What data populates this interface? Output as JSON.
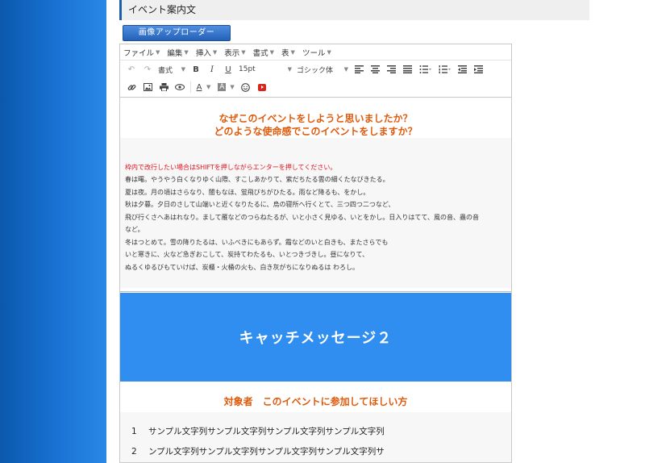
{
  "section": {
    "title": "イベント案内文"
  },
  "upload_button": {
    "label": "画像アップローダー"
  },
  "menubar": {
    "items": [
      {
        "label": "ファイル"
      },
      {
        "label": "編集"
      },
      {
        "label": "挿入"
      },
      {
        "label": "表示"
      },
      {
        "label": "書式"
      },
      {
        "label": "表"
      },
      {
        "label": "ツール"
      }
    ]
  },
  "toolbar": {
    "format_label": "書式",
    "bold": "B",
    "italic": "I",
    "underline": "U",
    "font_size": "15pt",
    "font_family": "ゴシック体",
    "text_color": "A",
    "bg_color": "A"
  },
  "content": {
    "heading_line1": "なぜこのイベントをしようと思いましたか？",
    "heading_line2": "どのような使命感でこのイベントをしますか？",
    "note": "枠内で改行したい場合はSHIFTを押しながらエンターを押してください。",
    "lines": [
      "春は曙。やうやう白くなりゆく山際、すこしあかりて、紫だちたる雲の細くたなびきたる。",
      "夏は夜。月の頃はさらなり、闇もなほ、蛍飛びちがひたる。雨など降るも、をかし。",
      "秋は夕暮。夕日のさして山端いと近くなりたるに、烏の寝所へ行くとて、三つ四つ二つなど、",
      "飛び行くさへあはれなり。まして雁などのつらねたるが、いと小さく見ゆる、いとをかし。日入りはてて、風の音、蟲の音",
      "など。",
      "冬はつとめて。雪の降りたるは、いふべきにもあらず。霜などのいと白きも、またさらでも",
      "いと寒きに、火など急ぎおこして、炭持てわたるも、いとつきづきし。昼になりて、",
      "ぬるくゆるびもていけば、炭櫃・火桶の火も、白き灰がちになりぬるは わろし。"
    ],
    "banner": "キャッチメッセージ２",
    "target_heading": "対象者　このイベントに参加してほしい方",
    "list": [
      {
        "num": "1",
        "text": "サンプル文字列サンプル文字列サンプル文字列サンプル文字列"
      },
      {
        "num": "2",
        "text": "ンプル文字列サンプル文字列サンプル文字列サンプル文字列サ"
      }
    ]
  }
}
